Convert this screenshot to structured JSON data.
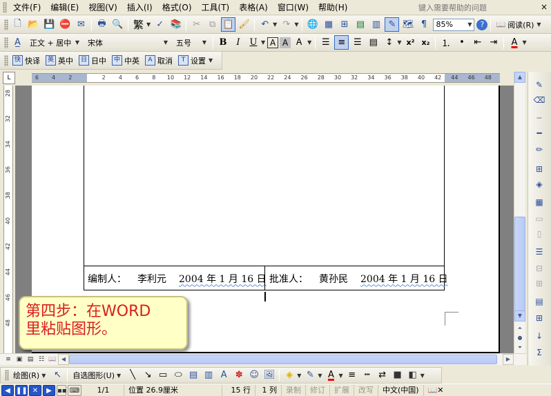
{
  "menu": {
    "items": [
      "文件(F)",
      "编辑(E)",
      "视图(V)",
      "插入(I)",
      "格式(O)",
      "工具(T)",
      "表格(A)",
      "窗口(W)",
      "帮助(H)"
    ],
    "help_placeholder": "键入需要帮助的问题",
    "close_glyph": "×"
  },
  "standard_toolbar": {
    "chinese_label": "繁",
    "zoom": "85%",
    "read_label": "阅读(R)"
  },
  "format_toolbar": {
    "style": "正文 + 居中",
    "font": "宋体",
    "size": "五号",
    "bold": "B",
    "italic": "I",
    "underline": "U",
    "char_border": "A",
    "char_shading": "A",
    "superscript": "x²",
    "subscript": "x₂"
  },
  "translate_toolbar": {
    "buttons": [
      {
        "icon": "快",
        "label": "快译"
      },
      {
        "icon": "英",
        "label": "英中"
      },
      {
        "icon": "日",
        "label": "日中"
      },
      {
        "icon": "中",
        "label": "中英"
      },
      {
        "icon": "A",
        "label": "取消"
      },
      {
        "icon": "T",
        "label": "设置"
      }
    ]
  },
  "ruler": {
    "corner": "L",
    "horizontal": [
      "6",
      "4",
      "2",
      "2",
      "4",
      "6",
      "8",
      "10",
      "12",
      "14",
      "16",
      "18",
      "20",
      "22",
      "24",
      "26",
      "28",
      "30",
      "32",
      "34",
      "36",
      "38",
      "40",
      "42",
      "44",
      "46",
      "48"
    ],
    "vertical": [
      "28",
      "32",
      "34",
      "36",
      "38",
      "40",
      "42",
      "44",
      "46",
      "48"
    ]
  },
  "document": {
    "sig_left_label": "编制人：",
    "sig_left_name": "李利元",
    "sig_left_date": "2004 年 1 月 16 日",
    "sig_right_label": "批准人：",
    "sig_right_name": "黄孙民",
    "sig_right_date": "2004 年 1 月 16 日"
  },
  "callout": {
    "text": "第四步：在WORD\n里粘贴图形。"
  },
  "draw_toolbar": {
    "draw_label": "绘图(R)",
    "autoshape_label": "自选图形(U)"
  },
  "statusbar": {
    "page": "1/1",
    "position": "位置 26.9厘米",
    "line": "15 行",
    "column": "1 列",
    "rec": "录制",
    "trk": "修订",
    "ext": "扩展",
    "ovr": "改写",
    "language": "中文(中国)"
  },
  "colors": {
    "callout_text": "#d81e1e",
    "callout_bg": "#ffffc6",
    "chrome": "#ece9d8",
    "accent_blue": "#2556c9"
  }
}
